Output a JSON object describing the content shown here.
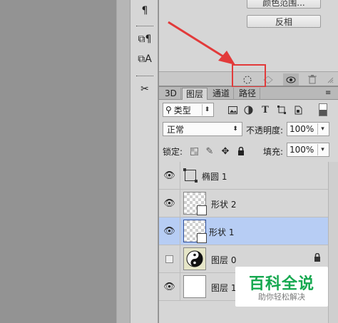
{
  "upper_panel": {
    "button_1_label": "颜色范围...",
    "button_2_label": "反相"
  },
  "tabs": [
    {
      "label": "3D"
    },
    {
      "label": "图层"
    },
    {
      "label": "通道"
    },
    {
      "label": "路径"
    }
  ],
  "layers_panel": {
    "filter_label": "类型",
    "blend_mode": "正常",
    "opacity_label": "不透明度:",
    "opacity_value": "100%",
    "lock_label": "锁定:",
    "fill_label": "填充:",
    "fill_value": "100%",
    "layers": [
      {
        "name": "椭圆 1",
        "visible": true,
        "selected": false,
        "thumb": "ellipse-shape-icon"
      },
      {
        "name": "形状 2",
        "visible": true,
        "selected": false,
        "thumb": "transparent"
      },
      {
        "name": "形状 1",
        "visible": true,
        "selected": true,
        "thumb": "transparent"
      },
      {
        "name": "图层 0",
        "visible": false,
        "selected": false,
        "thumb": "yin-yang",
        "locked": true
      },
      {
        "name": "图层 1",
        "visible": true,
        "selected": false,
        "thumb": "white"
      }
    ]
  },
  "watermark": {
    "title": "百科全说",
    "subtitle": "助你轻松解决"
  },
  "colors": {
    "highlight_box": "#e23a3a",
    "selected_row": "#b7cdf4",
    "arrow": "#e23a3a",
    "watermark_green": "#15a84f"
  }
}
